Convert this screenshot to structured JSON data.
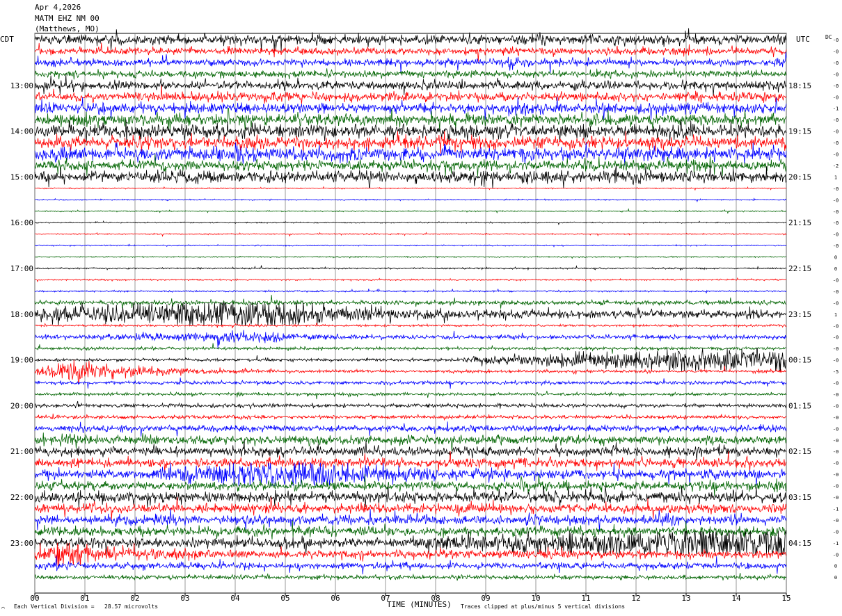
{
  "header": {
    "date": "Apr 4,2026",
    "station": "MATM EHZ NM 00",
    "location": "(Matthews, MO)"
  },
  "left_axis_label": "CDT",
  "right_axis_label": "UTC",
  "dc_label": "DC",
  "footer": {
    "scale_note": "Each Vertical Division =   28.57 microvolts",
    "xlabel": "TIME (MINUTES)",
    "clip_note": "Traces clipped at plus/minus 5 vertical divisions",
    "corner_mark": "⌒"
  },
  "colors": {
    "trace_cycle": [
      "#000000",
      "#ff0000",
      "#0000ff",
      "#006400"
    ],
    "grid": "#808080"
  },
  "chart_data": {
    "type": "helicorder",
    "x_ticks": [
      "00",
      "01",
      "02",
      "03",
      "04",
      "05",
      "06",
      "07",
      "08",
      "09",
      "10",
      "11",
      "12",
      "13",
      "14",
      "15"
    ],
    "x_range": [
      0,
      15
    ],
    "minutes_per_line": 15,
    "left_hour_labels": [
      {
        "line": 4,
        "label": "13:00"
      },
      {
        "line": 8,
        "label": "14:00"
      },
      {
        "line": 12,
        "label": "15:00"
      },
      {
        "line": 16,
        "label": "16:00"
      },
      {
        "line": 20,
        "label": "17:00"
      },
      {
        "line": 24,
        "label": "18:00"
      },
      {
        "line": 28,
        "label": "19:00"
      },
      {
        "line": 32,
        "label": "20:00"
      },
      {
        "line": 36,
        "label": "21:00"
      },
      {
        "line": 40,
        "label": "22:00"
      },
      {
        "line": 44,
        "label": "23:00"
      }
    ],
    "right_hour_labels": [
      {
        "line": 4,
        "label": "18:15"
      },
      {
        "line": 8,
        "label": "19:15"
      },
      {
        "line": 12,
        "label": "20:15"
      },
      {
        "line": 16,
        "label": "21:15"
      },
      {
        "line": 20,
        "label": "22:15"
      },
      {
        "line": 24,
        "label": "23:15"
      },
      {
        "line": 28,
        "label": "00:15"
      },
      {
        "line": 32,
        "label": "01:15"
      },
      {
        "line": 36,
        "label": "02:15"
      },
      {
        "line": 40,
        "label": "03:15"
      },
      {
        "line": 44,
        "label": "04:15"
      }
    ],
    "dc_offsets": [
      "-0",
      "-0",
      "-0",
      "-0",
      "-0",
      "-0",
      "-1",
      "-0",
      "-0",
      "-0",
      "-0",
      "-2",
      "1",
      "-0",
      "-0",
      "-0",
      "-0",
      "-0",
      "-0",
      "0",
      "0",
      "-0",
      "-0",
      "-0",
      "1",
      "-0",
      "-0",
      "-0",
      "-0",
      "-5",
      "-0",
      "-0",
      "-0",
      "-0",
      "-0",
      "-0",
      "-0",
      "-0",
      "-0",
      "-0",
      "-0",
      "-1",
      "-0",
      "-0",
      "-1",
      "-0",
      "0",
      "0"
    ],
    "trace_count": 48,
    "noise_level": [
      1.4,
      1.0,
      1.0,
      1.0,
      1.2,
      1.3,
      1.5,
      1.6,
      1.8,
      1.7,
      1.9,
      1.5,
      1.6,
      0.15,
      0.15,
      0.15,
      0.15,
      0.15,
      0.15,
      0.15,
      0.2,
      0.2,
      0.2,
      0.6,
      1.2,
      0.3,
      0.6,
      0.4,
      0.4,
      0.4,
      0.5,
      0.4,
      0.5,
      0.5,
      0.9,
      1.3,
      1.3,
      1.3,
      1.3,
      1.3,
      1.5,
      1.3,
      1.3,
      1.3,
      1.4,
      1.2,
      0.9,
      0.6
    ],
    "events": [
      {
        "line": 24,
        "start_min": 0.0,
        "peak_min": 4.5,
        "end_min": 9.2,
        "peak_amp": 5,
        "clipped": true
      },
      {
        "line": 26,
        "start_min": 1.0,
        "peak_min": 4.5,
        "end_min": 7.0,
        "peak_amp": 1.6
      },
      {
        "line": 29,
        "start_min": 0.0,
        "peak_min": 0.8,
        "end_min": 4.8,
        "peak_amp": 5,
        "clipped": true
      },
      {
        "line": 28,
        "start_min": 8.5,
        "peak_min": 15.0,
        "end_min": 15.0,
        "peak_amp": 5,
        "clipped": true
      },
      {
        "line": 38,
        "start_min": 2.2,
        "peak_min": 5.5,
        "end_min": 10.5,
        "peak_amp": 4.5
      },
      {
        "line": 44,
        "start_min": 7.5,
        "peak_min": 15.0,
        "end_min": 15.0,
        "peak_amp": 5,
        "clipped": true
      },
      {
        "line": 45,
        "start_min": 0.0,
        "peak_min": 0.8,
        "end_min": 3.5,
        "peak_amp": 5,
        "clipped": true
      }
    ]
  }
}
